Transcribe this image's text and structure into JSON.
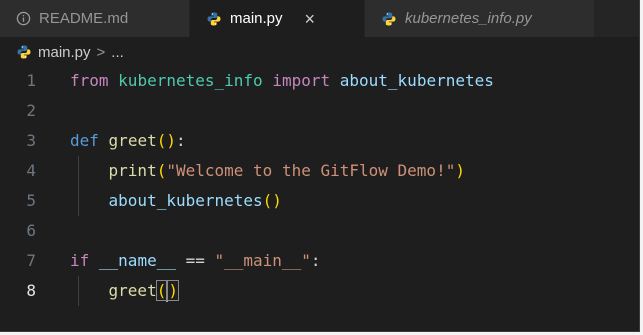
{
  "tabs": [
    {
      "label": "README.md",
      "icon": "info-icon",
      "active": false,
      "italic": false
    },
    {
      "label": "main.py",
      "icon": "python-icon",
      "active": true,
      "italic": false,
      "close": "×"
    },
    {
      "label": "kubernetes_info.py",
      "icon": "python-icon",
      "active": false,
      "italic": true
    }
  ],
  "breadcrumb": {
    "file": "main.py",
    "separator": ">",
    "more": "..."
  },
  "editor": {
    "current_line": 8,
    "lines": [
      {
        "num": "1",
        "tokens": [
          [
            "kw",
            "from"
          ],
          [
            "op",
            " "
          ],
          [
            "mod",
            "kubernetes_info"
          ],
          [
            "op",
            " "
          ],
          [
            "kw",
            "import"
          ],
          [
            "op",
            " "
          ],
          [
            "id",
            "about_kubernetes"
          ]
        ]
      },
      {
        "num": "2",
        "tokens": []
      },
      {
        "num": "3",
        "tokens": [
          [
            "kw2",
            "def"
          ],
          [
            "op",
            " "
          ],
          [
            "fn",
            "greet"
          ],
          [
            "punc-y",
            "()"
          ],
          [
            "op",
            ":"
          ]
        ]
      },
      {
        "num": "4",
        "tokens": [
          [
            "op",
            "    "
          ],
          [
            "fn",
            "print"
          ],
          [
            "punc-y",
            "("
          ],
          [
            "str",
            "\"Welcome to the GitFlow Demo!\""
          ],
          [
            "punc-y",
            ")"
          ]
        ]
      },
      {
        "num": "5",
        "tokens": [
          [
            "op",
            "    "
          ],
          [
            "id",
            "about_kubernetes"
          ],
          [
            "punc-y",
            "()"
          ]
        ]
      },
      {
        "num": "6",
        "tokens": []
      },
      {
        "num": "7",
        "tokens": [
          [
            "kw",
            "if"
          ],
          [
            "op",
            " "
          ],
          [
            "id",
            "__name__"
          ],
          [
            "op",
            " == "
          ],
          [
            "str",
            "\"__main__\""
          ],
          [
            "op",
            ":"
          ]
        ]
      },
      {
        "num": "8",
        "tokens": [
          [
            "op",
            "    "
          ],
          [
            "fn",
            "greet"
          ],
          [
            "punc-y",
            "()"
          ]
        ]
      }
    ]
  },
  "colors": {
    "python_blue": "#3572A5",
    "python_yellow": "#FFD43B"
  }
}
